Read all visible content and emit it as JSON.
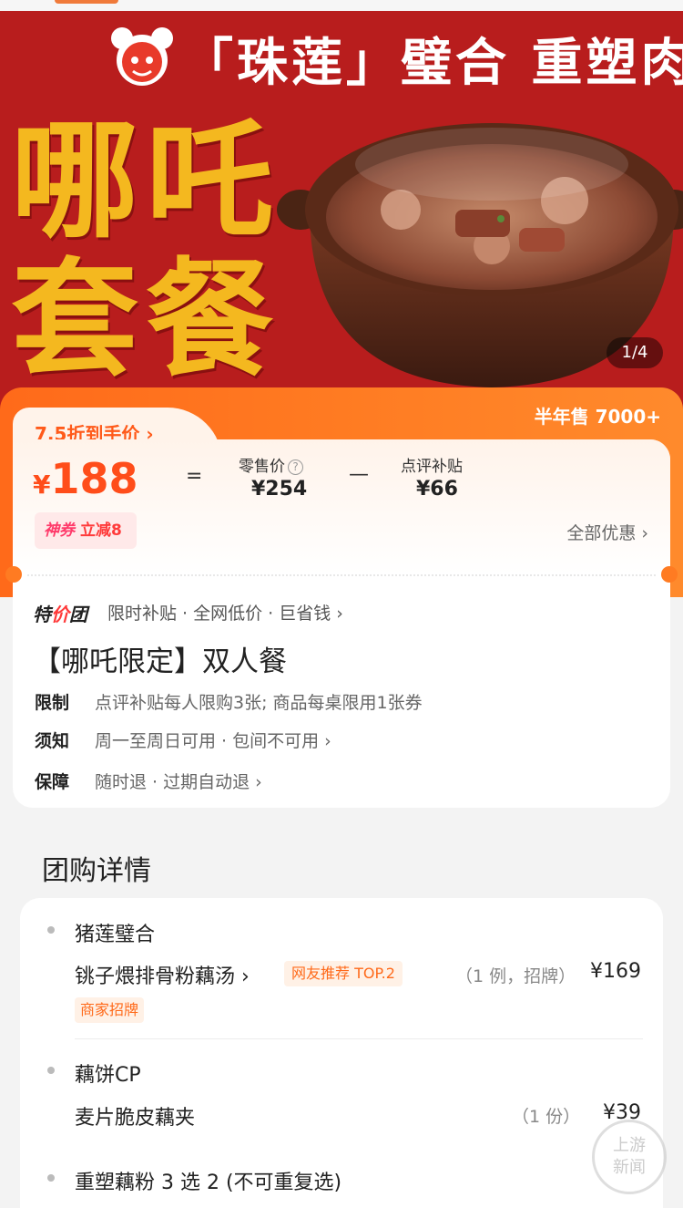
{
  "banner": {
    "slogan": "「珠莲」璧合 重塑肉身",
    "title_line1": "哪吒",
    "title_line2": "套餐",
    "page_counter": "1/4"
  },
  "price": {
    "discount_label": "7.5折到手价 ›",
    "half_year_sales": "半年售 7000+",
    "currency": "¥",
    "final_price": "188",
    "equals": "=",
    "minus": "—",
    "retail_label": "零售价",
    "retail_value": "¥254",
    "subsidy_label": "点评补贴",
    "subsidy_value": "¥66",
    "coupon_brand": "神券",
    "coupon_text": "立减8",
    "all_offers": "全部优惠 ›"
  },
  "deal": {
    "tejia_prefix": "特",
    "tejia_mid": "价",
    "tejia_suffix": "团",
    "tejia_desc": "限时补贴 · 全网低价 · 巨省钱 ›",
    "title": "【哪吒限定】双人餐",
    "rows": [
      {
        "key": "限制",
        "value": "点评补贴每人限购3张; 商品每桌限用1张券"
      },
      {
        "key": "须知",
        "value": "周一至周日可用 · 包间不可用 ›"
      },
      {
        "key": "保障",
        "value": "随时退 · 过期自动退 ›"
      }
    ]
  },
  "details": {
    "section_title": "团购详情",
    "groups": [
      {
        "name": "猪莲璧合",
        "item": "铫子煨排骨粉藕汤 ›",
        "tag_recommend": "网友推荐 TOP.2",
        "tag_shop": "商家招牌",
        "qty": "（1 例，招牌）",
        "price": "¥169"
      },
      {
        "name": "藕饼CP",
        "item": "麦片脆皮藕夹",
        "qty": "（1 份）",
        "price": "¥39"
      },
      {
        "name": "重塑藕粉 3 选 2 (不可重复选)"
      }
    ]
  },
  "watermark": {
    "line1": "上游",
    "line2": "新闻"
  },
  "colors": {
    "accent": "#ff6a1a",
    "banner_red": "#b81d1d",
    "title_yellow": "#f4b81f"
  }
}
